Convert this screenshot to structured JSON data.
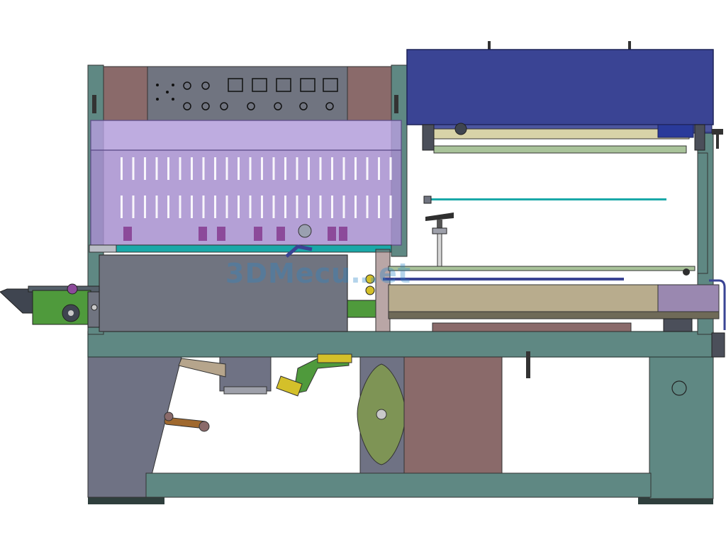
{
  "watermark": {
    "text": "3DMecu…et"
  },
  "palette": {
    "frame": "#5f8883",
    "frame_dark": "#3f5d5a",
    "panel_grey": "#707480",
    "brown": "#8a6a6a",
    "tunnel_purple": "#a78fcf",
    "hood_blue": "#3a4494",
    "green": "#4f9a3c",
    "olive": "#7e9455",
    "cyan": "#1aa8a8"
  },
  "parts": [
    {
      "name": "control-panel",
      "icon": "knob-panel"
    },
    {
      "name": "shrink-tunnel",
      "icon": "slotted-hood"
    },
    {
      "name": "film-roll-hood",
      "icon": "blue-cover"
    },
    {
      "name": "conveyor-infeed",
      "icon": "gear-drive"
    },
    {
      "name": "sealing-table",
      "icon": "platform"
    },
    {
      "name": "base-frame",
      "icon": "frame"
    }
  ]
}
